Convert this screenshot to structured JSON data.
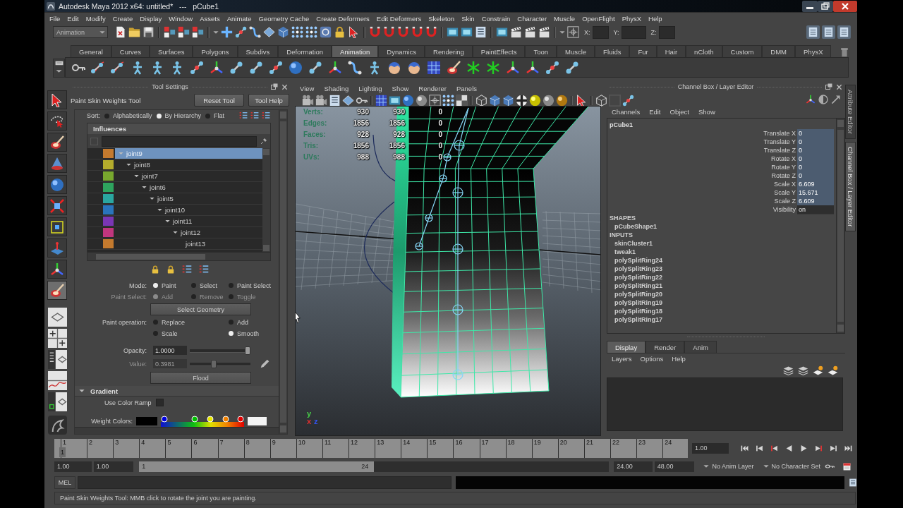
{
  "window": {
    "title": "Autodesk Maya 2012 x64: untitled*   ---   pCube1"
  },
  "menu_bar": [
    "File",
    "Edit",
    "Modify",
    "Create",
    "Display",
    "Window",
    "Assets",
    "Animate",
    "Geometry Cache",
    "Create Deformers",
    "Edit Deformers",
    "Skeleton",
    "Skin",
    "Constrain",
    "Character",
    "Muscle",
    "OpenFlight",
    "PhysX",
    "Help"
  ],
  "status_line": {
    "menu_set": "Animation",
    "coordinate_labels": [
      "X:",
      "Y:",
      "Z:"
    ]
  },
  "shelf": {
    "tabs": [
      {
        "label": "General",
        "selected": false
      },
      {
        "label": "Curves",
        "selected": false
      },
      {
        "label": "Surfaces",
        "selected": false
      },
      {
        "label": "Polygons",
        "selected": false
      },
      {
        "label": "Subdivs",
        "selected": false
      },
      {
        "label": "Deformation",
        "selected": false
      },
      {
        "label": "Animation",
        "selected": true
      },
      {
        "label": "Dynamics",
        "selected": false
      },
      {
        "label": "Rendering",
        "selected": false
      },
      {
        "label": "PaintEffects",
        "selected": false
      },
      {
        "label": "Toon",
        "selected": false
      },
      {
        "label": "Muscle",
        "selected": false
      },
      {
        "label": "Fluids",
        "selected": false
      },
      {
        "label": "Fur",
        "selected": false
      },
      {
        "label": "Hair",
        "selected": false
      },
      {
        "label": "nCloth",
        "selected": false
      },
      {
        "label": "Custom",
        "selected": false
      },
      {
        "label": "DMM",
        "selected": false
      },
      {
        "label": "PhysX",
        "selected": false
      }
    ]
  },
  "toolbox": [
    {
      "selected": false
    },
    {
      "selected": false
    },
    {
      "selected": false
    },
    {
      "selected": false
    },
    {
      "selected": false
    },
    {
      "selected": false
    },
    {
      "selected": false
    },
    {
      "selected": false
    },
    {
      "selected": false
    },
    {
      "selected": true
    }
  ],
  "tool_settings": {
    "title": "Tool Settings",
    "tool_name": "Paint Skin Weights Tool",
    "buttons": [
      "Reset Tool",
      "Tool Help"
    ],
    "sort": {
      "label": "Sort:",
      "options": [
        {
          "label": "Alphabetically",
          "selected": false
        },
        {
          "label": "By Hierarchy",
          "selected": true
        },
        {
          "label": "Flat",
          "selected": false
        }
      ]
    },
    "influences": {
      "title": "Influences",
      "joints": [
        {
          "name": "joint9",
          "color": "#c47a2e",
          "selected": true,
          "children": [
            {
              "name": "joint8",
              "color": "#b4ac2c",
              "selected": false,
              "children": [
                {
                  "name": "joint7",
                  "color": "#78a82e",
                  "selected": false,
                  "children": [
                    {
                      "name": "joint6",
                      "color": "#2ea45e",
                      "selected": false,
                      "children": [
                        {
                          "name": "joint5",
                          "color": "#2aa6a0",
                          "selected": false,
                          "children": [
                            {
                              "name": "joint10",
                              "color": "#2a74bc",
                              "selected": false,
                              "children": [
                                {
                                  "name": "joint11",
                                  "color": "#7a36b4",
                                  "selected": false,
                                  "children": [
                                    {
                                      "name": "joint12",
                                      "color": "#c0367e",
                                      "selected": false,
                                      "children": [
                                        {
                                          "name": "joint13",
                                          "color": "#c47a2e",
                                          "selected": false
                                        }
                                      ]
                                    }
                                  ]
                                }
                              ]
                            }
                          ]
                        }
                      ]
                    }
                  ]
                }
              ]
            }
          ]
        }
      ]
    },
    "mode": {
      "label": "Mode:",
      "disabled": false,
      "options": [
        {
          "label": "Paint",
          "selected": true
        },
        {
          "label": "Select",
          "selected": false
        },
        {
          "label": "Paint Select",
          "selected": false
        }
      ]
    },
    "paint_select": {
      "label": "Paint Select:",
      "disabled": true,
      "options": [
        {
          "label": "Add",
          "selected": true
        },
        {
          "label": "Remove",
          "selected": false
        },
        {
          "label": "Toggle",
          "selected": false
        }
      ]
    },
    "select_geometry_button": "Select Geometry",
    "paint_operation": {
      "label": "Paint operation:",
      "disabled": false,
      "options": [
        {
          "label": "Replace",
          "selected": false
        },
        {
          "label": "Add",
          "selected": false
        },
        {
          "label": "Scale",
          "selected": false
        },
        {
          "label": "Smooth",
          "selected": true
        }
      ]
    },
    "opacity": {
      "label": "Opacity:",
      "value": "1.0000",
      "level": 0.95,
      "disabled": false
    },
    "weight_value": {
      "label": "Value:",
      "value": "0.3981",
      "level": 0.4,
      "disabled": true
    },
    "flood_button": "Flood",
    "gradient": {
      "title": "Gradient",
      "expanded": true,
      "use_color_ramp": {
        "label": "Use Color Ramp",
        "checked": false
      },
      "weight_colors_label": "Weight Colors:"
    }
  },
  "viewport": {
    "menus": [
      "View",
      "Shading",
      "Lighting",
      "Show",
      "Renderer",
      "Panels"
    ],
    "hud": [
      {
        "label": "Verts:",
        "values": [
          "930",
          "930",
          "0"
        ]
      },
      {
        "label": "Edges:",
        "values": [
          "1856",
          "1856",
          "0"
        ]
      },
      {
        "label": "Faces:",
        "values": [
          "928",
          "928",
          "0"
        ]
      },
      {
        "label": "Tris:",
        "values": [
          "1856",
          "1856",
          "0"
        ]
      },
      {
        "label": "UVs:",
        "values": [
          "988",
          "988",
          "0"
        ]
      }
    ],
    "axis_labels": [
      {
        "label": "y",
        "color": "#48d048"
      },
      {
        "label": "x",
        "color": "#e03030"
      },
      {
        "label": "z",
        "color": "#3454f0"
      }
    ]
  },
  "channel_box": {
    "title": "Channel Box / Layer Editor",
    "menus": [
      "Channels",
      "Edit",
      "Object",
      "Show"
    ],
    "object": "pCube1",
    "attributes": [
      {
        "label": "Translate X",
        "value": "0",
        "selected": true
      },
      {
        "label": "Translate Y",
        "value": "0",
        "selected": true
      },
      {
        "label": "Translate Z",
        "value": "0",
        "selected": true
      },
      {
        "label": "Rotate X",
        "value": "0",
        "selected": true
      },
      {
        "label": "Rotate Y",
        "value": "0",
        "selected": true
      },
      {
        "label": "Rotate Z",
        "value": "0",
        "selected": true
      },
      {
        "label": "Scale X",
        "value": "6.609",
        "selected": true
      },
      {
        "label": "Scale Y",
        "value": "15.671",
        "selected": true
      },
      {
        "label": "Scale Z",
        "value": "6.609",
        "selected": true
      },
      {
        "label": "Visibility",
        "value": "on",
        "selected": false
      }
    ],
    "sections": [
      {
        "title": "SHAPES",
        "items": [
          "pCubeShape1"
        ]
      },
      {
        "title": "INPUTS",
        "items": [
          "skinCluster1",
          "tweak1",
          "polySplitRing24",
          "polySplitRing23",
          "polySplitRing22",
          "polySplitRing21",
          "polySplitRing20",
          "polySplitRing19",
          "polySplitRing18",
          "polySplitRing17"
        ]
      }
    ]
  },
  "layer_editor": {
    "tabs": [
      {
        "label": "Display",
        "selected": true
      },
      {
        "label": "Render",
        "selected": false
      },
      {
        "label": "Anim",
        "selected": false
      }
    ],
    "menus": [
      "Layers",
      "Options",
      "Help"
    ]
  },
  "side_tabs": [
    {
      "label": "Attribute Editor",
      "selected": false
    },
    {
      "label": "Channel Box / Layer Editor",
      "selected": true
    }
  ],
  "time_slider": {
    "frames": [
      "1",
      "2",
      "3",
      "4",
      "5",
      "6",
      "7",
      "8",
      "9",
      "10",
      "11",
      "12",
      "13",
      "14",
      "15",
      "16",
      "17",
      "18",
      "19",
      "20",
      "21",
      "22",
      "23",
      "24"
    ],
    "current_frame": "1",
    "current_time": "1.00"
  },
  "range_slider": {
    "start_time": "1.00",
    "playback_start": "1.00",
    "range_start": "1",
    "range_end": "24",
    "level": 0.5,
    "playback_end": "24.00",
    "end_time": "48.00",
    "anim_layer": "No Anim Layer",
    "character_set": "No Character Set"
  },
  "command_line": {
    "language": "MEL"
  },
  "help_line": "Paint Skin Weights Tool: MMB click to rotate the joint you are painting."
}
